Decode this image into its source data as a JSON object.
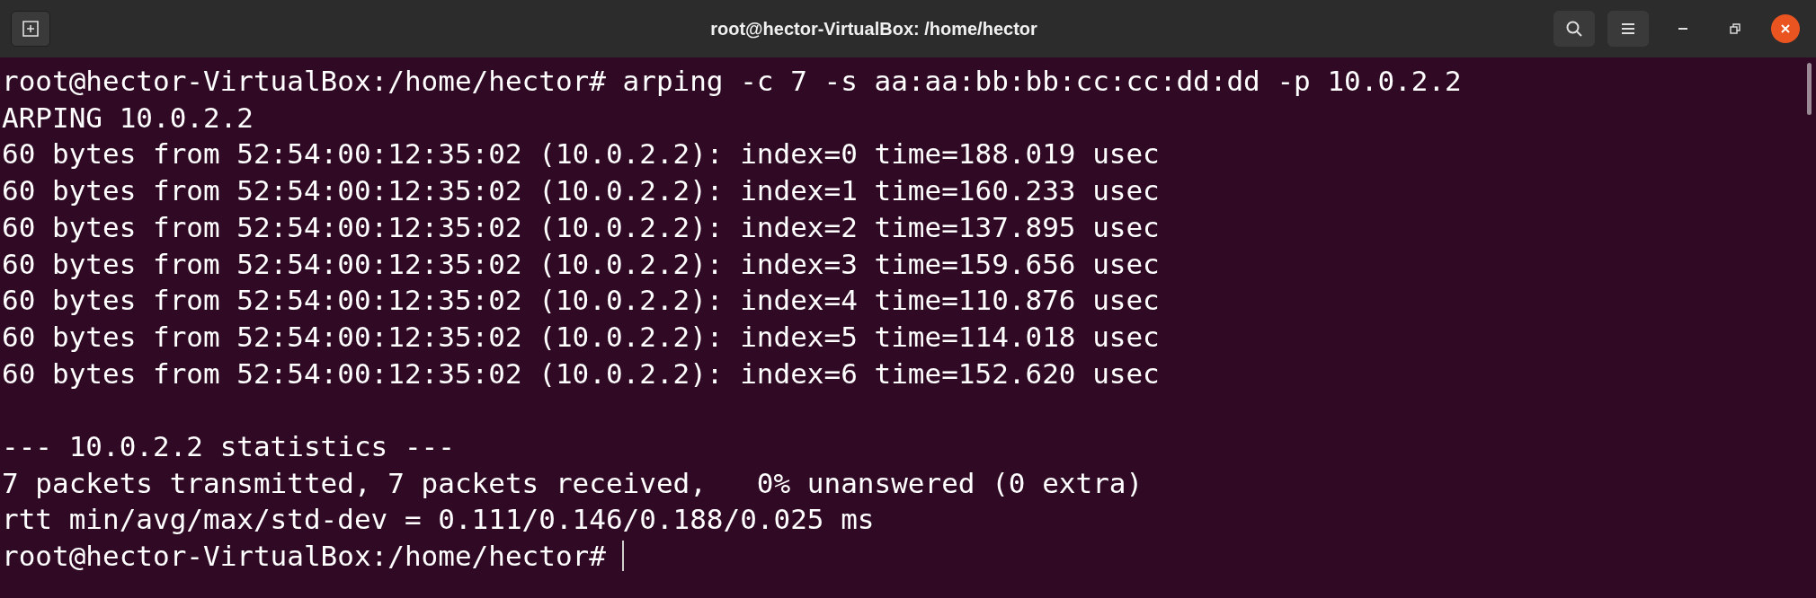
{
  "window": {
    "title": "root@hector-VirtualBox: /home/hector"
  },
  "terminal": {
    "lines": [
      {
        "kind": "output",
        "text": "root@hector-VirtualBox:/home/hector# arping -c 7 -s aa:aa:bb:bb:cc:cc:dd:dd -p 10.0.2.2"
      },
      {
        "kind": "output",
        "text": "ARPING 10.0.2.2"
      },
      {
        "kind": "output",
        "text": "60 bytes from 52:54:00:12:35:02 (10.0.2.2): index=0 time=188.019 usec"
      },
      {
        "kind": "output",
        "text": "60 bytes from 52:54:00:12:35:02 (10.0.2.2): index=1 time=160.233 usec"
      },
      {
        "kind": "output",
        "text": "60 bytes from 52:54:00:12:35:02 (10.0.2.2): index=2 time=137.895 usec"
      },
      {
        "kind": "output",
        "text": "60 bytes from 52:54:00:12:35:02 (10.0.2.2): index=3 time=159.656 usec"
      },
      {
        "kind": "output",
        "text": "60 bytes from 52:54:00:12:35:02 (10.0.2.2): index=4 time=110.876 usec"
      },
      {
        "kind": "output",
        "text": "60 bytes from 52:54:00:12:35:02 (10.0.2.2): index=5 time=114.018 usec"
      },
      {
        "kind": "output",
        "text": "60 bytes from 52:54:00:12:35:02 (10.0.2.2): index=6 time=152.620 usec"
      },
      {
        "kind": "blank"
      },
      {
        "kind": "output",
        "text": "--- 10.0.2.2 statistics ---"
      },
      {
        "kind": "output",
        "text": "7 packets transmitted, 7 packets received,   0% unanswered (0 extra)"
      },
      {
        "kind": "output",
        "text": "rtt min/avg/max/std-dev = 0.111/0.146/0.188/0.025 ms"
      },
      {
        "kind": "prompt",
        "text": "root@hector-VirtualBox:/home/hector#",
        "cursor": true
      }
    ]
  }
}
